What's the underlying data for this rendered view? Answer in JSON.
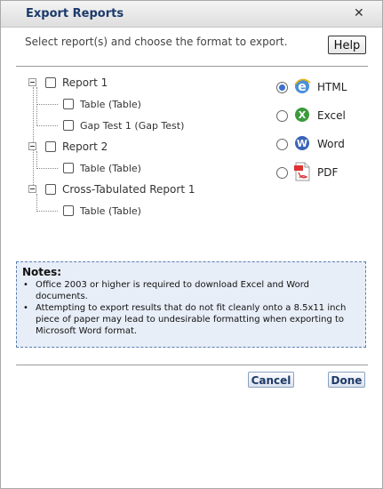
{
  "dialog": {
    "title": "Export Reports",
    "instruction": "Select report(s) and choose the format to export.",
    "help_label": "Help"
  },
  "tree": [
    {
      "label": "Report 1",
      "children": [
        "Table (Table)",
        "Gap Test 1 (Gap Test)"
      ]
    },
    {
      "label": "Report 2",
      "children": [
        "Table (Table)"
      ]
    },
    {
      "label": "Cross-Tabulated Report 1",
      "children": [
        "Table (Table)"
      ]
    }
  ],
  "formats": [
    {
      "label": "HTML",
      "icon": "ie-icon",
      "selected": true
    },
    {
      "label": "Excel",
      "icon": "excel-icon",
      "selected": false
    },
    {
      "label": "Word",
      "icon": "word-icon",
      "selected": false
    },
    {
      "label": "PDF",
      "icon": "pdf-icon",
      "selected": false
    }
  ],
  "notes": {
    "title": "Notes:",
    "items": [
      "Office 2003 or higher is required to download Excel and Word documents.",
      "Attempting to export results that do not fit cleanly onto a 8.5x11 inch piece of paper may lead to undesirable formatting when exporting to Microsoft Word format."
    ]
  },
  "buttons": {
    "cancel": "Cancel",
    "done": "Done"
  }
}
